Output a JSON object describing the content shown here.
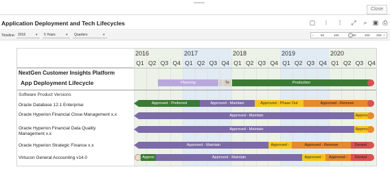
{
  "topbar": {
    "close_label": "Close"
  },
  "header": {
    "title": "Application Deployment and Tech Lifecycles",
    "toolbar_icons": [
      "fit-icon",
      "expand-width-icon",
      "collapse-width-icon",
      "fullscreen-icon",
      "search-icon",
      "save-icon",
      "print-icon"
    ]
  },
  "filters": {
    "timeline_label": "Timeline:",
    "timeline_value": "2016",
    "span_value": "5 Years",
    "unit_value": "Quarters",
    "zoom_ticks": [
      "50",
      "100",
      "150",
      "200",
      "250"
    ],
    "zoom_value": 150
  },
  "timeline": {
    "years": [
      "2016",
      "2017",
      "2018",
      "2019",
      "2020"
    ],
    "quarters": [
      "Q1",
      "Q2",
      "Q3",
      "Q4",
      "Q1",
      "Q2",
      "Q3",
      "Q4",
      "Q1",
      "Q2",
      "Q3",
      "Q4",
      "Q1",
      "Q2",
      "Q3",
      "Q4",
      "Q1",
      "Q2",
      "Q3",
      "Q4"
    ]
  },
  "project": {
    "name": "NextGen Customer Insights Platform",
    "lifecycle_label": "App Deployment Lifecycle",
    "phases": {
      "planning": "Planning",
      "test": "Te",
      "production": "Production"
    }
  },
  "section_label": "Software Product Versions",
  "rows": [
    {
      "name": "Oracle Database 12.1 Enterprise",
      "bars": [
        "Approved - Preferred",
        "Approved - Maintain",
        "Approved - Phase Out",
        "Approved - Remove"
      ]
    },
    {
      "name": "Oracle Hyperion Financial Close Management x.x",
      "bars": [
        "Approved - Maintain",
        "Approve"
      ]
    },
    {
      "name": "Oracle Hyperion Financial Data Quality Management x.x",
      "bars": [
        "Approved - Maintain",
        "Approve"
      ]
    },
    {
      "name": "Oracle Hyperion Strategic Finance x.x",
      "bars": [
        "Approved - Maintain",
        "Approved -",
        "Approved - Remove",
        "Denied"
      ]
    },
    {
      "name": "Virtucon General Accounting v14.0",
      "bars": [
        "Approv",
        "Approved - Maintain",
        "Approved -",
        "Approved -",
        "Denied"
      ]
    }
  ],
  "colors": {
    "maintain": "#7d6aa8",
    "preferred": "#3b7a33",
    "phase_out": "#f5c518",
    "remove": "#e8892c",
    "denied": "#d85350",
    "planning": "#b9a8dc"
  }
}
